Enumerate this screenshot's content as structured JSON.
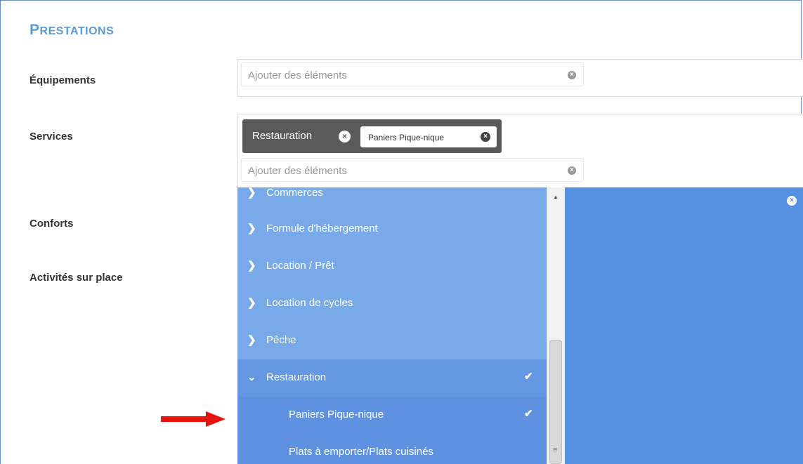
{
  "section_title": {
    "first": "P",
    "rest": "RESTATIONS"
  },
  "labels": {
    "equipements": "Équipements",
    "services": "Services",
    "conforts": "Conforts",
    "activites": "Activités sur place"
  },
  "equipements_input": {
    "placeholder": "Ajouter des éléments"
  },
  "services_tags": {
    "main": "Restauration",
    "sub": "Paniers Pique-nique"
  },
  "services_input": {
    "placeholder": "Ajouter des éléments"
  },
  "dropdown": {
    "items": [
      {
        "label": "Commerces"
      },
      {
        "label": "Formule d'hébergement"
      },
      {
        "label": "Location / Prêt"
      },
      {
        "label": "Location de cycles"
      },
      {
        "label": "Pêche"
      },
      {
        "label": "Restauration"
      },
      {
        "label": "Paniers Pique-nique"
      },
      {
        "label": "Plats à emporter/Plats cuisinés"
      }
    ]
  },
  "colors": {
    "accent": "#5b9bd5",
    "dropdown": "#78a9e8",
    "selected": "#5e92e0",
    "arrow": "#e8120c"
  },
  "icons": {
    "expand": "chevron-right-icon",
    "collapse": "chevron-down-icon",
    "selected": "check-icon",
    "clear": "close-circle-icon"
  }
}
